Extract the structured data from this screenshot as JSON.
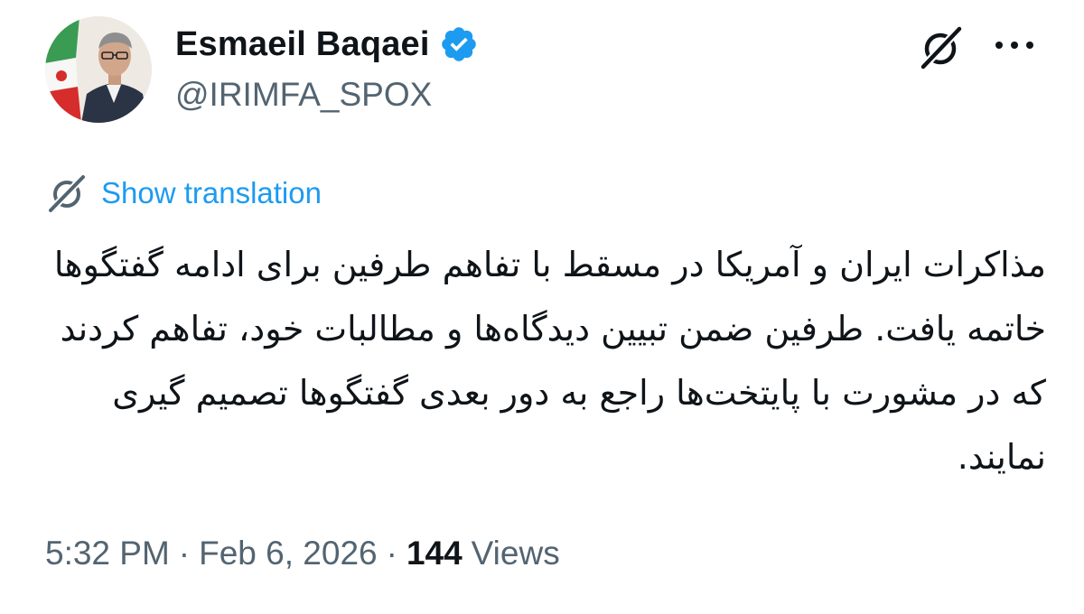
{
  "author": {
    "display_name": "Esmaeil Baqaei",
    "handle": "@IRIMFA_SPOX",
    "verified": true,
    "avatar_icon": "profile-photo-with-iran-flag"
  },
  "header_actions": {
    "grok_icon": "grok-icon",
    "more_icon": "more-dots-icon"
  },
  "translation": {
    "icon": "grok-icon",
    "label": "Show translation"
  },
  "tweet": {
    "text": "مذاکرات ایران و آمریکا در مسقط با تفاهم طرفین برای ادامه گفتگوها خاتمه یافت. طرفین ضمن تبیین دیدگاه‌ها و مطالبات خود، تفاهم کردند که در مشورت با پایتخت‌ها راجع به دور بعدی گفتگوها تصمیم گیری نمایند."
  },
  "meta": {
    "time": "5:32 PM",
    "separator": "·",
    "date": "Feb 6, 2026",
    "views_count": "144",
    "views_label": "Views"
  },
  "colors": {
    "accent": "#1d9bf0",
    "secondary_text": "#536471",
    "primary_text": "#0f1419"
  }
}
